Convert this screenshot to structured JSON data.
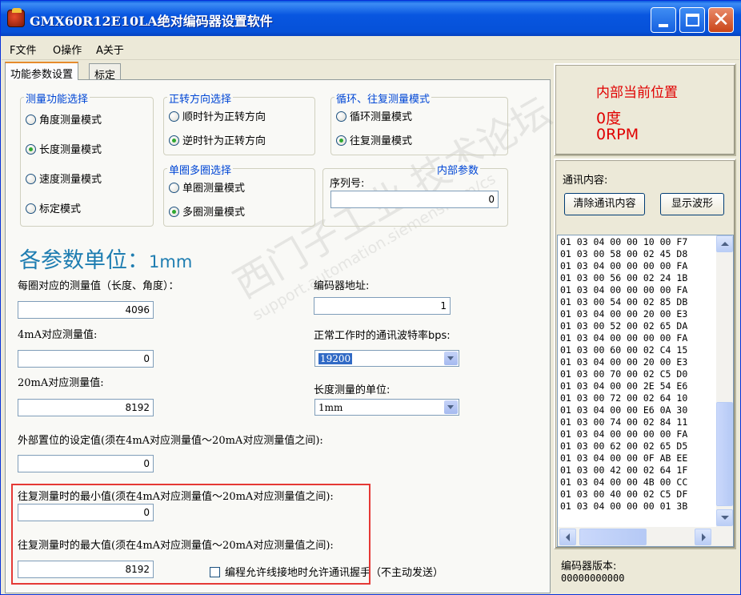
{
  "window": {
    "title": "GMX60R12E10LA绝对编码器设置软件"
  },
  "menu": [
    "F文件",
    "O操作",
    "A关于"
  ],
  "tabs": [
    "功能参数设置",
    "标定"
  ],
  "measure_function": {
    "title": "测量功能选择",
    "options": [
      "角度测量模式",
      "长度测量模式",
      "速度测量模式",
      "标定模式"
    ],
    "selected": "长度测量模式"
  },
  "direction": {
    "title": "正转方向选择",
    "options": [
      "顺时针为正转方向",
      "逆时针为正转方向"
    ],
    "selected": "逆时针为正转方向"
  },
  "cycle_mode": {
    "title": "循环、往复测量模式",
    "options": [
      "循环测量模式",
      "往复测量模式"
    ],
    "selected": "往复测量模式"
  },
  "turn_mode": {
    "title": "单圈多圈选择",
    "options": [
      "单圈测量模式",
      "多圈测量模式"
    ],
    "selected": "多圈测量模式"
  },
  "internal_params": {
    "title": "内部参数",
    "serial_label": "序列号:",
    "serial_value": "0"
  },
  "units_title": "各参数单位：",
  "units_value": "1mm",
  "params": {
    "per_turn_label": "每圈对应的测量值（长度、角度）：",
    "per_turn_value": "4096",
    "ma4_label": "4mA对应测量值:",
    "ma4_value": "0",
    "ma20_label": "20mA对应测量值:",
    "ma20_value": "8192",
    "external_label": "外部置位的设定值(须在4mA对应测量值～20mA对应测量值之间):",
    "external_value": "0",
    "min_label": "往复测量时的最小值(须在4mA对应测量值～20mA对应测量值之间):",
    "min_value": "0",
    "max_label": "往复测量时的最大值(须在4mA对应测量值～20mA对应测量值之间):",
    "max_value": "8192",
    "address_label": "编码器地址:",
    "address_value": "1",
    "baud_label": "正常工作时的通讯波特率bps:",
    "baud_value": "19200",
    "length_unit_label": "长度测量的单位:",
    "length_unit_value": "1mm",
    "handshake_label": "编程允许线接地时允许通讯握手（不主动发送）"
  },
  "watermark": {
    "line1": "西门子工业 技术论坛",
    "line2": "support.automation.siemens.com/cs"
  },
  "position": {
    "title": "内部当前位置",
    "degrees": "0度",
    "rpm": "0RPM"
  },
  "comm": {
    "title": "通讯内容:",
    "clear_button": "清除通讯内容",
    "wave_button": "显示波形",
    "log": [
      "01 03 04 00 00 10 00 F7",
      "01 03 00 58 00 02 45 D8",
      "01 03 04 00 00 00 00 FA",
      "01 03 00 56 00 02 24 1B",
      "01 03 04 00 00 00 00 FA",
      "01 03 00 54 00 02 85 DB",
      "01 03 04 00 00 20 00 E3",
      "01 03 00 52 00 02 65 DA",
      "01 03 04 00 00 00 00 FA",
      "01 03 00 60 00 02 C4 15",
      "01 03 04 00 00 20 00 E3",
      "01 03 00 70 00 02 C5 D0",
      "01 03 04 00 00 2E 54 E6",
      "01 03 00 72 00 02 64 10",
      "01 03 04 00 00 E6 0A 30",
      "01 03 00 74 00 02 84 11",
      "01 03 04 00 00 00 00 FA",
      "01 03 00 62 00 02 65 D5",
      "01 03 04 00 00 0F AB EE",
      "01 03 00 42 00 02 64 1F",
      "01 03 04 00 00 4B 00 CC",
      "01 03 00 40 00 02 C5 DF",
      "01 03 04 00 00 00 01 3B"
    ]
  },
  "version": {
    "label": "编码器版本:",
    "value": "00000000000"
  }
}
